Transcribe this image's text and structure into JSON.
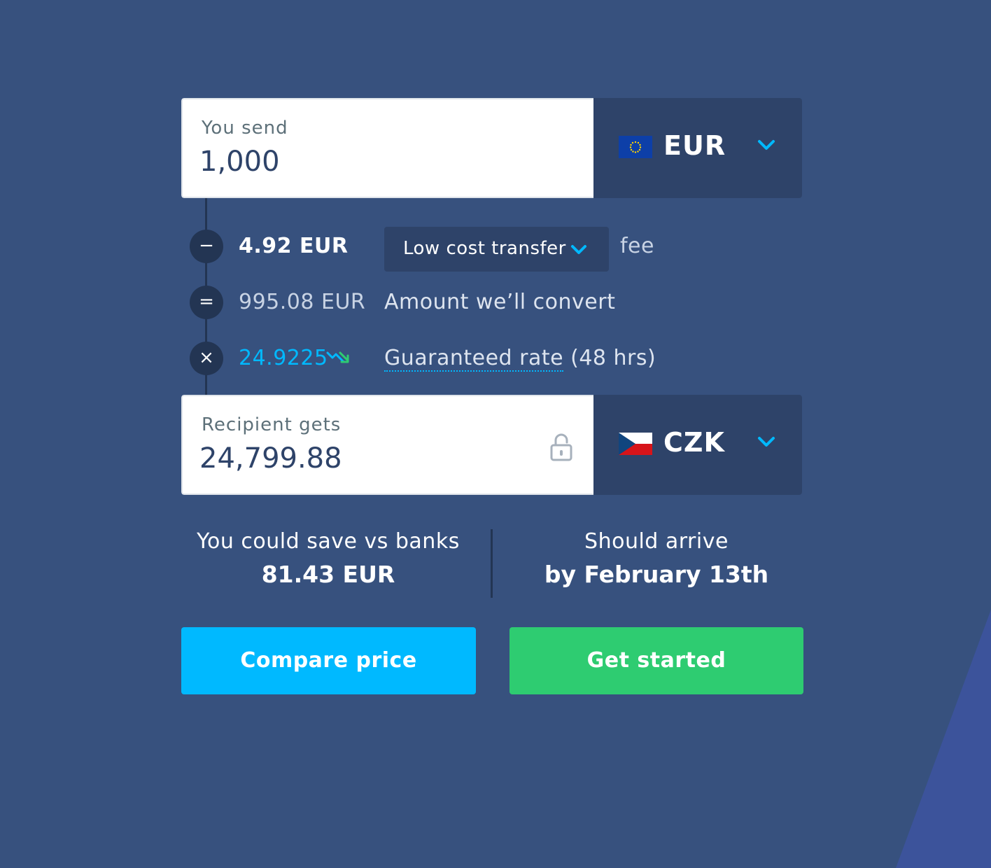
{
  "send": {
    "label": "You send",
    "amount": "1,000",
    "currency": "EUR",
    "flag_icon": "eu-flag-icon"
  },
  "fee": {
    "operator": "−",
    "amount": "4.92 EUR",
    "transfer_type": "Low cost transfer",
    "label": "fee"
  },
  "convert": {
    "operator": "=",
    "amount": "995.08 EUR",
    "label": "Amount we’ll convert"
  },
  "rate": {
    "operator": "×",
    "value": "24.9225",
    "link_label": "Guaranteed rate",
    "suffix": " (48 hrs)",
    "trend_icon": "trend-down-icon"
  },
  "receive": {
    "label": "Recipient gets",
    "amount": "24,799.88",
    "currency": "CZK",
    "flag_icon": "cz-flag-icon"
  },
  "savings": {
    "title": "You could save vs banks",
    "value": "81.43 EUR"
  },
  "arrival": {
    "title": "Should arrive",
    "value": "by February 13th"
  },
  "buttons": {
    "compare": "Compare price",
    "start": "Get started"
  },
  "colors": {
    "background": "#37517e",
    "dark": "#2e4369",
    "accent_blue": "#00b9ff",
    "accent_green": "#2ecc71"
  }
}
